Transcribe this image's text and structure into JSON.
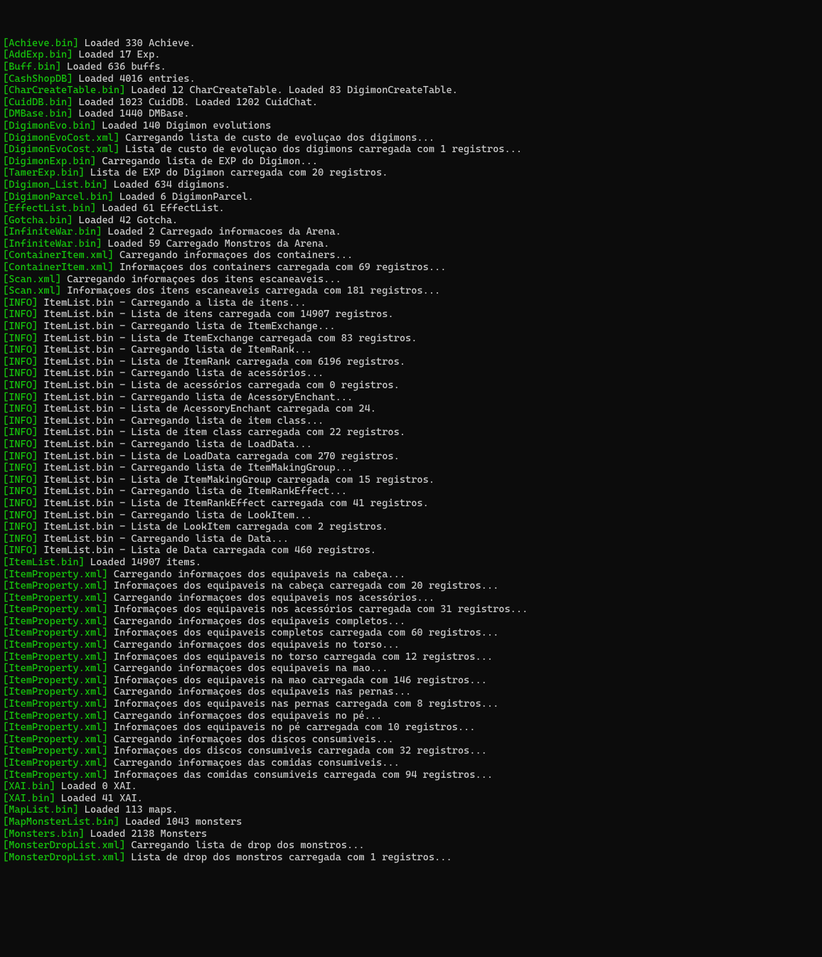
{
  "lines": [
    {
      "tag": "[Achieve.bin]",
      "msg": " Loaded 330 Achieve."
    },
    {
      "tag": "[AddExp.bin]",
      "msg": " Loaded 17 Exp."
    },
    {
      "tag": "[Buff.bin]",
      "msg": " Loaded 636 buffs."
    },
    {
      "tag": "[CashShopDB]",
      "msg": " Loaded 4016 entries."
    },
    {
      "tag": "[CharCreateTable.bin]",
      "msg": " Loaded 12 CharCreateTable. Loaded 83 DigimonCreateTable."
    },
    {
      "tag": "[CuidDB.bin]",
      "msg": " Loaded 1023 CuidDB. Loaded 1202 CuidChat."
    },
    {
      "tag": "[DMBase.bin]",
      "msg": " Loaded 1440 DMBase."
    },
    {
      "tag": "[DigimonEvo.bin]",
      "msg": " Loaded 140 Digimon evolutions"
    },
    {
      "tag": "[DigimonEvoCost.xml]",
      "msg": " Carregando lista de custo de evoluçao dos digimons..."
    },
    {
      "tag": "[DigimonEvoCost.xml]",
      "msg": " Lista de custo de evoluçao dos digimons carregada com 1 registros..."
    },
    {
      "tag": "[DigimonExp.bin]",
      "msg": " Carregando lista de EXP do Digimon..."
    },
    {
      "tag": "[TamerExp.bin]",
      "msg": " Lista de EXP do Digimon carregada com 20 registros."
    },
    {
      "tag": "[Digimon_List.bin]",
      "msg": " Loaded 634 digimons."
    },
    {
      "tag": "[DigimonParcel.bin]",
      "msg": " Loaded 6 DigimonParcel."
    },
    {
      "tag": "[EffectList.bin]",
      "msg": " Loaded 61 EffectList."
    },
    {
      "tag": "[Gotcha.bin]",
      "msg": " Loaded 42 Gotcha."
    },
    {
      "tag": "[InfiniteWar.bin]",
      "msg": " Loaded 2 Carregado informacoes da Arena."
    },
    {
      "tag": "[InfiniteWar.bin]",
      "msg": " Loaded 59 Carregado Monstros da Arena."
    },
    {
      "tag": "[ContainerItem.xml]",
      "msg": " Carregando informaçoes dos containers..."
    },
    {
      "tag": "[ContainerItem.xml]",
      "msg": " Informaçoes dos containers carregada com 69 registros..."
    },
    {
      "tag": "[Scan.xml]",
      "msg": " Carregando informaçoes dos itens escaneaveis..."
    },
    {
      "tag": "[Scan.xml]",
      "msg": " Informaçoes dos itens escaneaveis carregada com 181 registros..."
    },
    {
      "tag": "[INFO]",
      "msg": " ItemList.bin - Carregando a lista de itens..."
    },
    {
      "tag": "[INFO]",
      "msg": " ItemList.bin - Lista de itens carregada com 14907 registros."
    },
    {
      "tag": "[INFO]",
      "msg": " ItemList.bin - Carregando lista de ItemExchange..."
    },
    {
      "tag": "[INFO]",
      "msg": " ItemList.bin - Lista de ItemExchange carregada com 83 registros."
    },
    {
      "tag": "[INFO]",
      "msg": " ItemList.bin - Carregando lista de ItemRank..."
    },
    {
      "tag": "[INFO]",
      "msg": " ItemList.bin - Lista de ItemRank carregada com 6196 registros."
    },
    {
      "tag": "[INFO]",
      "msg": " ItemList.bin - Carregando lista de acessórios..."
    },
    {
      "tag": "[INFO]",
      "msg": " ItemList.bin - Lista de acessórios carregada com 0 registros."
    },
    {
      "tag": "[INFO]",
      "msg": " ItemList.bin - Carregando lista de AcessoryEnchant..."
    },
    {
      "tag": "[INFO]",
      "msg": " ItemList.bin - Lista de AcessoryEnchant carregada com 24."
    },
    {
      "tag": "[INFO]",
      "msg": " ItemList.bin - Carregando lista de item class..."
    },
    {
      "tag": "[INFO]",
      "msg": " ItemList.bin - Lista de item class carregada com 22 registros."
    },
    {
      "tag": "[INFO]",
      "msg": " ItemList.bin - Carregando lista de LoadData..."
    },
    {
      "tag": "[INFO]",
      "msg": " ItemList.bin - Lista de LoadData carregada com 270 registros."
    },
    {
      "tag": "[INFO]",
      "msg": " ItemList.bin - Carregando lista de ItemMakingGroup..."
    },
    {
      "tag": "[INFO]",
      "msg": " ItemList.bin - Lista de ItemMakingGroup carregada com 15 registros."
    },
    {
      "tag": "[INFO]",
      "msg": " ItemList.bin - Carregando lista de ItemRankEffect..."
    },
    {
      "tag": "[INFO]",
      "msg": " ItemList.bin - Lista de ItemRankEffect carregada com 41 registros."
    },
    {
      "tag": "[INFO]",
      "msg": " ItemList.bin - Carregando lista de LookItem..."
    },
    {
      "tag": "[INFO]",
      "msg": " ItemList.bin - Lista de LookItem carregada com 2 registros."
    },
    {
      "tag": "[INFO]",
      "msg": " ItemList.bin - Carregando lista de Data..."
    },
    {
      "tag": "[INFO]",
      "msg": " ItemList.bin - Lista de Data carregada com 460 registros."
    },
    {
      "tag": "[ItemList.bin]",
      "msg": " Loaded 14907 items."
    },
    {
      "tag": "[ItemProperty.xml]",
      "msg": " Carregando informaçoes dos equipaveis na cabeça..."
    },
    {
      "tag": "[ItemProperty.xml]",
      "msg": " Informaçoes dos equipaveis na cabeça carregada com 20 registros..."
    },
    {
      "tag": "[ItemProperty.xml]",
      "msg": " Carregando informaçoes dos equipaveis nos acessórios..."
    },
    {
      "tag": "[ItemProperty.xml]",
      "msg": " Informaçoes dos equipaveis nos acessórios carregada com 31 registros..."
    },
    {
      "tag": "[ItemProperty.xml]",
      "msg": " Carregando informaçoes dos equipaveis completos..."
    },
    {
      "tag": "[ItemProperty.xml]",
      "msg": " Informaçoes dos equipaveis completos carregada com 60 registros..."
    },
    {
      "tag": "[ItemProperty.xml]",
      "msg": " Carregando informaçoes dos equipaveis no torso..."
    },
    {
      "tag": "[ItemProperty.xml]",
      "msg": " Informaçoes dos equipaveis no torso carregada com 12 registros..."
    },
    {
      "tag": "[ItemProperty.xml]",
      "msg": " Carregando informaçoes dos equipaveis na mao..."
    },
    {
      "tag": "[ItemProperty.xml]",
      "msg": " Informaçoes dos equipaveis na mao carregada com 146 registros..."
    },
    {
      "tag": "[ItemProperty.xml]",
      "msg": " Carregando informaçoes dos equipaveis nas pernas..."
    },
    {
      "tag": "[ItemProperty.xml]",
      "msg": " Informaçoes dos equipaveis nas pernas carregada com 8 registros..."
    },
    {
      "tag": "[ItemProperty.xml]",
      "msg": " Carregando informaçoes dos equipaveis no pé..."
    },
    {
      "tag": "[ItemProperty.xml]",
      "msg": " Informaçoes dos equipaveis no pé carregada com 10 registros..."
    },
    {
      "tag": "[ItemProperty.xml]",
      "msg": " Carregando informaçoes dos discos consumiveis..."
    },
    {
      "tag": "[ItemProperty.xml]",
      "msg": " Informaçoes dos discos consumiveis carregada com 32 registros..."
    },
    {
      "tag": "[ItemProperty.xml]",
      "msg": " Carregando informaçoes das comidas consumiveis..."
    },
    {
      "tag": "[ItemProperty.xml]",
      "msg": " Informaçoes das comidas consumiveis carregada com 94 registros..."
    },
    {
      "tag": "[XAI.bin]",
      "msg": " Loaded 0 XAI."
    },
    {
      "tag": "[XAI.bin]",
      "msg": " Loaded 41 XAI."
    },
    {
      "tag": "[MapList.bin]",
      "msg": " Loaded 113 maps."
    },
    {
      "tag": "[MapMonsterList.bin]",
      "msg": " Loaded 1043 monsters"
    },
    {
      "tag": "[Monsters.bin]",
      "msg": " Loaded 2138 Monsters"
    },
    {
      "tag": "[MonsterDropList.xml]",
      "msg": " Carregando lista de drop dos monstros..."
    },
    {
      "tag": "[MonsterDropList.xml]",
      "msg": " Lista de drop dos monstros carregada com 1 registros..."
    }
  ]
}
